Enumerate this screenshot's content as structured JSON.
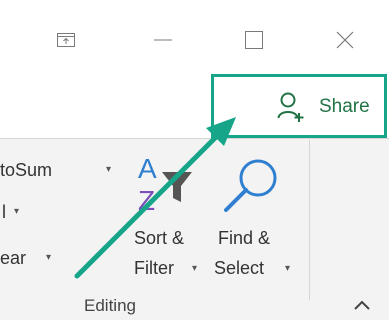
{
  "window_controls": {
    "ribbon_display": "ribbon-display-options-icon",
    "minimize": "minimize-icon",
    "maximize": "maximize-icon",
    "close": "close-icon"
  },
  "share": {
    "label": "Share",
    "icon": "share-person-add-icon",
    "highlight_color": "#17a589"
  },
  "editing_group": {
    "autosum_label": "toSum",
    "fill_label": "l",
    "clear_label": "ear",
    "sort_filter_line1": "Sort &",
    "sort_filter_line2": "Filter",
    "find_select_line1": "Find &",
    "find_select_line2": "Select",
    "group_label": "Editing",
    "collapse_icon": "chevron-up-icon"
  },
  "annotation": {
    "arrow_color": "#17a589"
  }
}
